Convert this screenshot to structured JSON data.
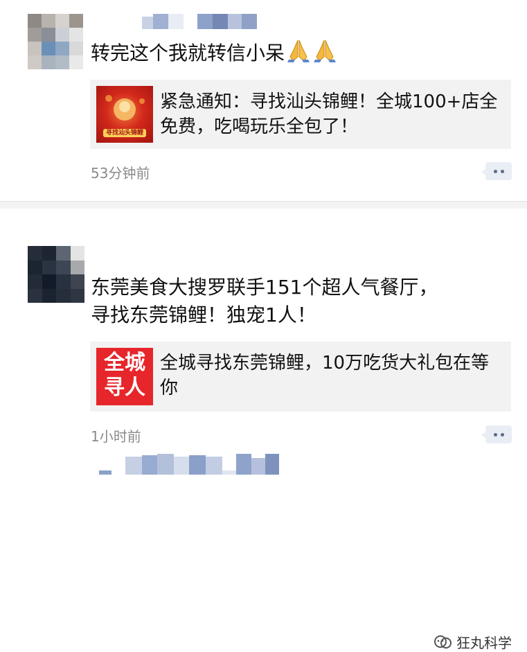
{
  "feed": {
    "posts": [
      {
        "text": "转完这个我就转信小呆",
        "emoji": "folded-hands-icon folded-hands-icon",
        "card": {
          "thumb_caption": "寻找汕头锦鲤",
          "title": "紧急通知：寻找汕头锦鲤！全城100+店全免费，吃喝玩乐全包了！"
        },
        "time": "53分钟前"
      },
      {
        "text_line1": "东莞美食大搜罗联手151个超人气餐厅，",
        "text_line2": "寻找东莞锦鲤！独宠1人！",
        "card": {
          "thumb_line1": "全城",
          "thumb_line2": "寻人",
          "title": "全城寻找东莞锦鲤，10万吃货大礼包在等你"
        },
        "time": "1小时前"
      }
    ]
  },
  "watermark": {
    "text": "狂丸科学",
    "icon": "wechat-channel-icon"
  },
  "colors": {
    "card_bg": "#f2f2f2",
    "time": "#8a8a8a",
    "accent_red": "#e6262b",
    "comment_icon": "#5b6b8c"
  }
}
